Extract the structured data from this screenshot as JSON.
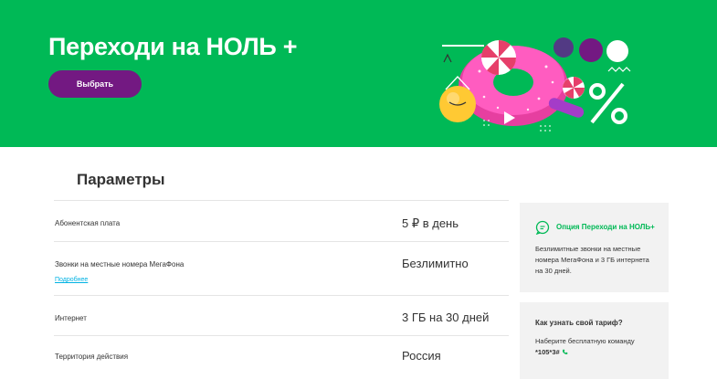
{
  "hero": {
    "title": "Переходи на НОЛЬ +",
    "button_label": "Выбрать",
    "colors": {
      "background": "#00b956",
      "button": "#731982"
    }
  },
  "params": {
    "title": "Параметры",
    "rows": [
      {
        "label": "Абонентская плата",
        "value": "5 ₽ в день"
      },
      {
        "label": "Звонки на местные номера МегаФона",
        "value": "Безлимитно",
        "more": "Подробнее"
      },
      {
        "label": "Интернет",
        "value": "3 ГБ на 30 дней"
      },
      {
        "label": "Территория действия",
        "value": "Россия"
      }
    ]
  },
  "sidebar": {
    "option_link": "Опция Переходи на НОЛЬ+",
    "option_text": "Безлимитные звонки на местные номера МегаФона и 3 ГБ интернета на 30 дней.",
    "tariff_question": "Как узнать свой тариф?",
    "tariff_text": "Наберите бесплатную команду",
    "tariff_code": "*105*3#"
  },
  "icons": [
    "chat-bubble-icon",
    "phone-icon",
    "percent-icon",
    "play-icon",
    "donut-illustration"
  ]
}
